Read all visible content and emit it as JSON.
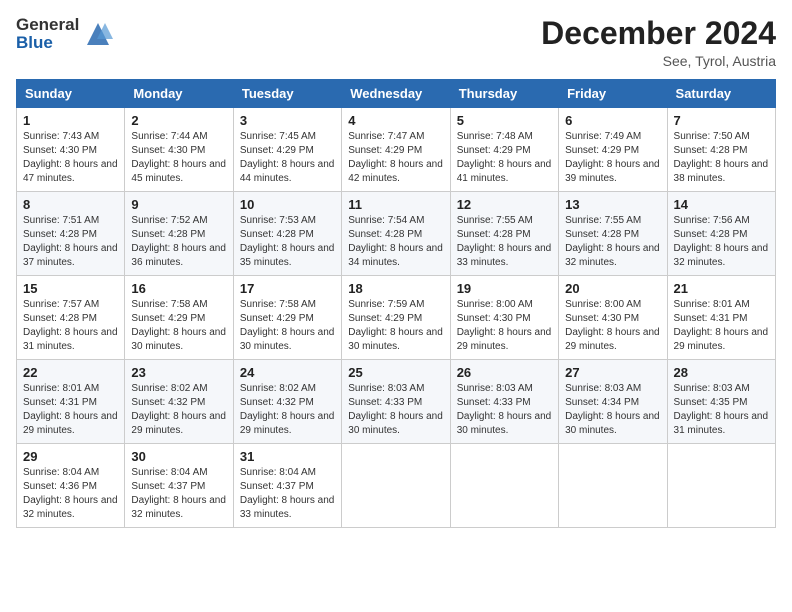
{
  "logo": {
    "line1": "General",
    "line2": "Blue"
  },
  "title": "December 2024",
  "location": "See, Tyrol, Austria",
  "days_header": [
    "Sunday",
    "Monday",
    "Tuesday",
    "Wednesday",
    "Thursday",
    "Friday",
    "Saturday"
  ],
  "weeks": [
    [
      {
        "day": "1",
        "sunrise": "7:43 AM",
        "sunset": "4:30 PM",
        "daylight": "8 hours and 47 minutes."
      },
      {
        "day": "2",
        "sunrise": "7:44 AM",
        "sunset": "4:30 PM",
        "daylight": "8 hours and 45 minutes."
      },
      {
        "day": "3",
        "sunrise": "7:45 AM",
        "sunset": "4:29 PM",
        "daylight": "8 hours and 44 minutes."
      },
      {
        "day": "4",
        "sunrise": "7:47 AM",
        "sunset": "4:29 PM",
        "daylight": "8 hours and 42 minutes."
      },
      {
        "day": "5",
        "sunrise": "7:48 AM",
        "sunset": "4:29 PM",
        "daylight": "8 hours and 41 minutes."
      },
      {
        "day": "6",
        "sunrise": "7:49 AM",
        "sunset": "4:29 PM",
        "daylight": "8 hours and 39 minutes."
      },
      {
        "day": "7",
        "sunrise": "7:50 AM",
        "sunset": "4:28 PM",
        "daylight": "8 hours and 38 minutes."
      }
    ],
    [
      {
        "day": "8",
        "sunrise": "7:51 AM",
        "sunset": "4:28 PM",
        "daylight": "8 hours and 37 minutes."
      },
      {
        "day": "9",
        "sunrise": "7:52 AM",
        "sunset": "4:28 PM",
        "daylight": "8 hours and 36 minutes."
      },
      {
        "day": "10",
        "sunrise": "7:53 AM",
        "sunset": "4:28 PM",
        "daylight": "8 hours and 35 minutes."
      },
      {
        "day": "11",
        "sunrise": "7:54 AM",
        "sunset": "4:28 PM",
        "daylight": "8 hours and 34 minutes."
      },
      {
        "day": "12",
        "sunrise": "7:55 AM",
        "sunset": "4:28 PM",
        "daylight": "8 hours and 33 minutes."
      },
      {
        "day": "13",
        "sunrise": "7:55 AM",
        "sunset": "4:28 PM",
        "daylight": "8 hours and 32 minutes."
      },
      {
        "day": "14",
        "sunrise": "7:56 AM",
        "sunset": "4:28 PM",
        "daylight": "8 hours and 32 minutes."
      }
    ],
    [
      {
        "day": "15",
        "sunrise": "7:57 AM",
        "sunset": "4:28 PM",
        "daylight": "8 hours and 31 minutes."
      },
      {
        "day": "16",
        "sunrise": "7:58 AM",
        "sunset": "4:29 PM",
        "daylight": "8 hours and 30 minutes."
      },
      {
        "day": "17",
        "sunrise": "7:58 AM",
        "sunset": "4:29 PM",
        "daylight": "8 hours and 30 minutes."
      },
      {
        "day": "18",
        "sunrise": "7:59 AM",
        "sunset": "4:29 PM",
        "daylight": "8 hours and 30 minutes."
      },
      {
        "day": "19",
        "sunrise": "8:00 AM",
        "sunset": "4:30 PM",
        "daylight": "8 hours and 29 minutes."
      },
      {
        "day": "20",
        "sunrise": "8:00 AM",
        "sunset": "4:30 PM",
        "daylight": "8 hours and 29 minutes."
      },
      {
        "day": "21",
        "sunrise": "8:01 AM",
        "sunset": "4:31 PM",
        "daylight": "8 hours and 29 minutes."
      }
    ],
    [
      {
        "day": "22",
        "sunrise": "8:01 AM",
        "sunset": "4:31 PM",
        "daylight": "8 hours and 29 minutes."
      },
      {
        "day": "23",
        "sunrise": "8:02 AM",
        "sunset": "4:32 PM",
        "daylight": "8 hours and 29 minutes."
      },
      {
        "day": "24",
        "sunrise": "8:02 AM",
        "sunset": "4:32 PM",
        "daylight": "8 hours and 29 minutes."
      },
      {
        "day": "25",
        "sunrise": "8:03 AM",
        "sunset": "4:33 PM",
        "daylight": "8 hours and 30 minutes."
      },
      {
        "day": "26",
        "sunrise": "8:03 AM",
        "sunset": "4:33 PM",
        "daylight": "8 hours and 30 minutes."
      },
      {
        "day": "27",
        "sunrise": "8:03 AM",
        "sunset": "4:34 PM",
        "daylight": "8 hours and 30 minutes."
      },
      {
        "day": "28",
        "sunrise": "8:03 AM",
        "sunset": "4:35 PM",
        "daylight": "8 hours and 31 minutes."
      }
    ],
    [
      {
        "day": "29",
        "sunrise": "8:04 AM",
        "sunset": "4:36 PM",
        "daylight": "8 hours and 32 minutes."
      },
      {
        "day": "30",
        "sunrise": "8:04 AM",
        "sunset": "4:37 PM",
        "daylight": "8 hours and 32 minutes."
      },
      {
        "day": "31",
        "sunrise": "8:04 AM",
        "sunset": "4:37 PM",
        "daylight": "8 hours and 33 minutes."
      },
      null,
      null,
      null,
      null
    ]
  ],
  "labels": {
    "sunrise": "Sunrise:",
    "sunset": "Sunset:",
    "daylight": "Daylight:"
  }
}
